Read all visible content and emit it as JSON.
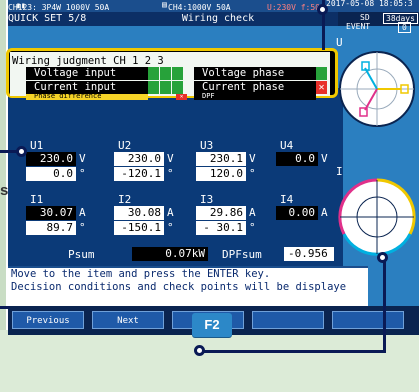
{
  "status_bar": {
    "channel_info": "CH123:  3P4W   1000V   50A",
    "ch4_info": "CH4:1000V   50A",
    "voltage_info": "U:230V f:50",
    "datetime": "2017-05-08 18:05:3",
    "sd_label": "SD",
    "sd_days": "38days",
    "event_label": "EVENT",
    "event_count": "0"
  },
  "title_bar": {
    "page_name": "QUICK SET 5/8",
    "screen_title": "Wiring check"
  },
  "wiring_judgment": {
    "title": "Wiring judgment  CH 1 2 3",
    "left_items": [
      {
        "label": "Voltage input",
        "status": "ok"
      },
      {
        "label": "Current input",
        "status": "ok"
      },
      {
        "label": "Phase difference",
        "status": "ng"
      }
    ],
    "right_items": [
      {
        "label": "Voltage phase",
        "status": "ok"
      },
      {
        "label": "Current phase",
        "status": "ng"
      },
      {
        "label": "DPF",
        "status": ""
      }
    ]
  },
  "voltage": {
    "headers": [
      "U1",
      "U2",
      "U3",
      "U4"
    ],
    "values": [
      "230.0",
      "230.0",
      "230.1",
      "0.0"
    ],
    "unit": "V",
    "phases": [
      "0.0",
      "-120.1",
      "120.0"
    ],
    "phase_unit": "°"
  },
  "current": {
    "headers": [
      "I1",
      "I2",
      "I3",
      "I4"
    ],
    "values": [
      "30.07",
      "30.08",
      "29.86",
      "0.00"
    ],
    "unit": "A",
    "phases": [
      "89.7",
      "-150.1",
      "- 30.1"
    ],
    "phase_unit": "°"
  },
  "totals": {
    "psum_label": "Psum",
    "psum_value": "0.07kW",
    "dpf_label": "DPFsum",
    "dpf_value": "-0.956"
  },
  "message": {
    "line1": "Move to the item and press the ENTER key.",
    "line2": "Decision conditions and check points will be displaye"
  },
  "function_keys": [
    "Previous",
    "Next",
    "",
    "",
    ""
  ],
  "circles": {
    "voltage_label": "U",
    "current_label": "I"
  },
  "hardware": {
    "f2_key": "F2"
  },
  "side_letter": "s"
}
